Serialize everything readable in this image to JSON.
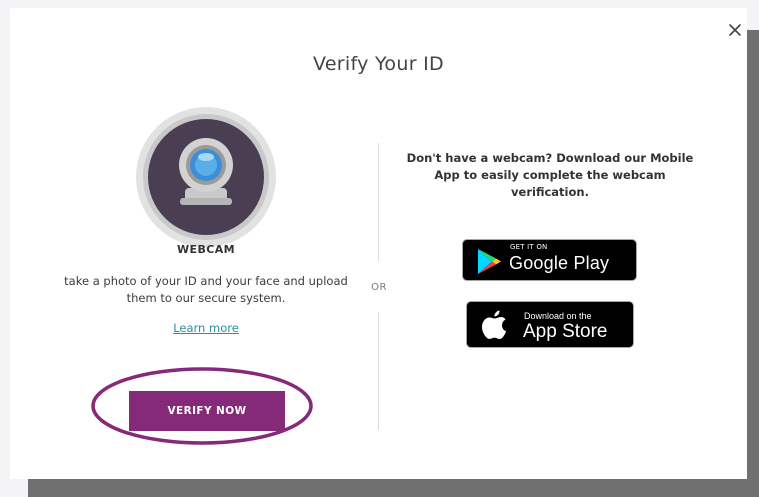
{
  "modal": {
    "title": "Verify Your ID",
    "close_icon": "close-icon"
  },
  "webcam_option": {
    "icon": "webcam-icon",
    "heading": "WEBCAM",
    "description": "take a photo of your ID and your face and upload them to our secure system.",
    "learn_more_label": "Learn more",
    "verify_button_label": "VERIFY NOW"
  },
  "separator_label": "OR",
  "mobile_option": {
    "prompt": "Don't have a webcam? Download our Mobile App to easily complete the webcam verification.",
    "google_play": {
      "icon": "google-play-icon",
      "small_text": "GET IT ON",
      "large_text": "Google Play"
    },
    "app_store": {
      "icon": "apple-icon",
      "small_text": "Download on the",
      "large_text": "App Store"
    }
  },
  "colors": {
    "primary_button": "#852a79",
    "highlight_ring": "#852a79",
    "link": "#2b8fa3",
    "backdrop": "#707070"
  }
}
